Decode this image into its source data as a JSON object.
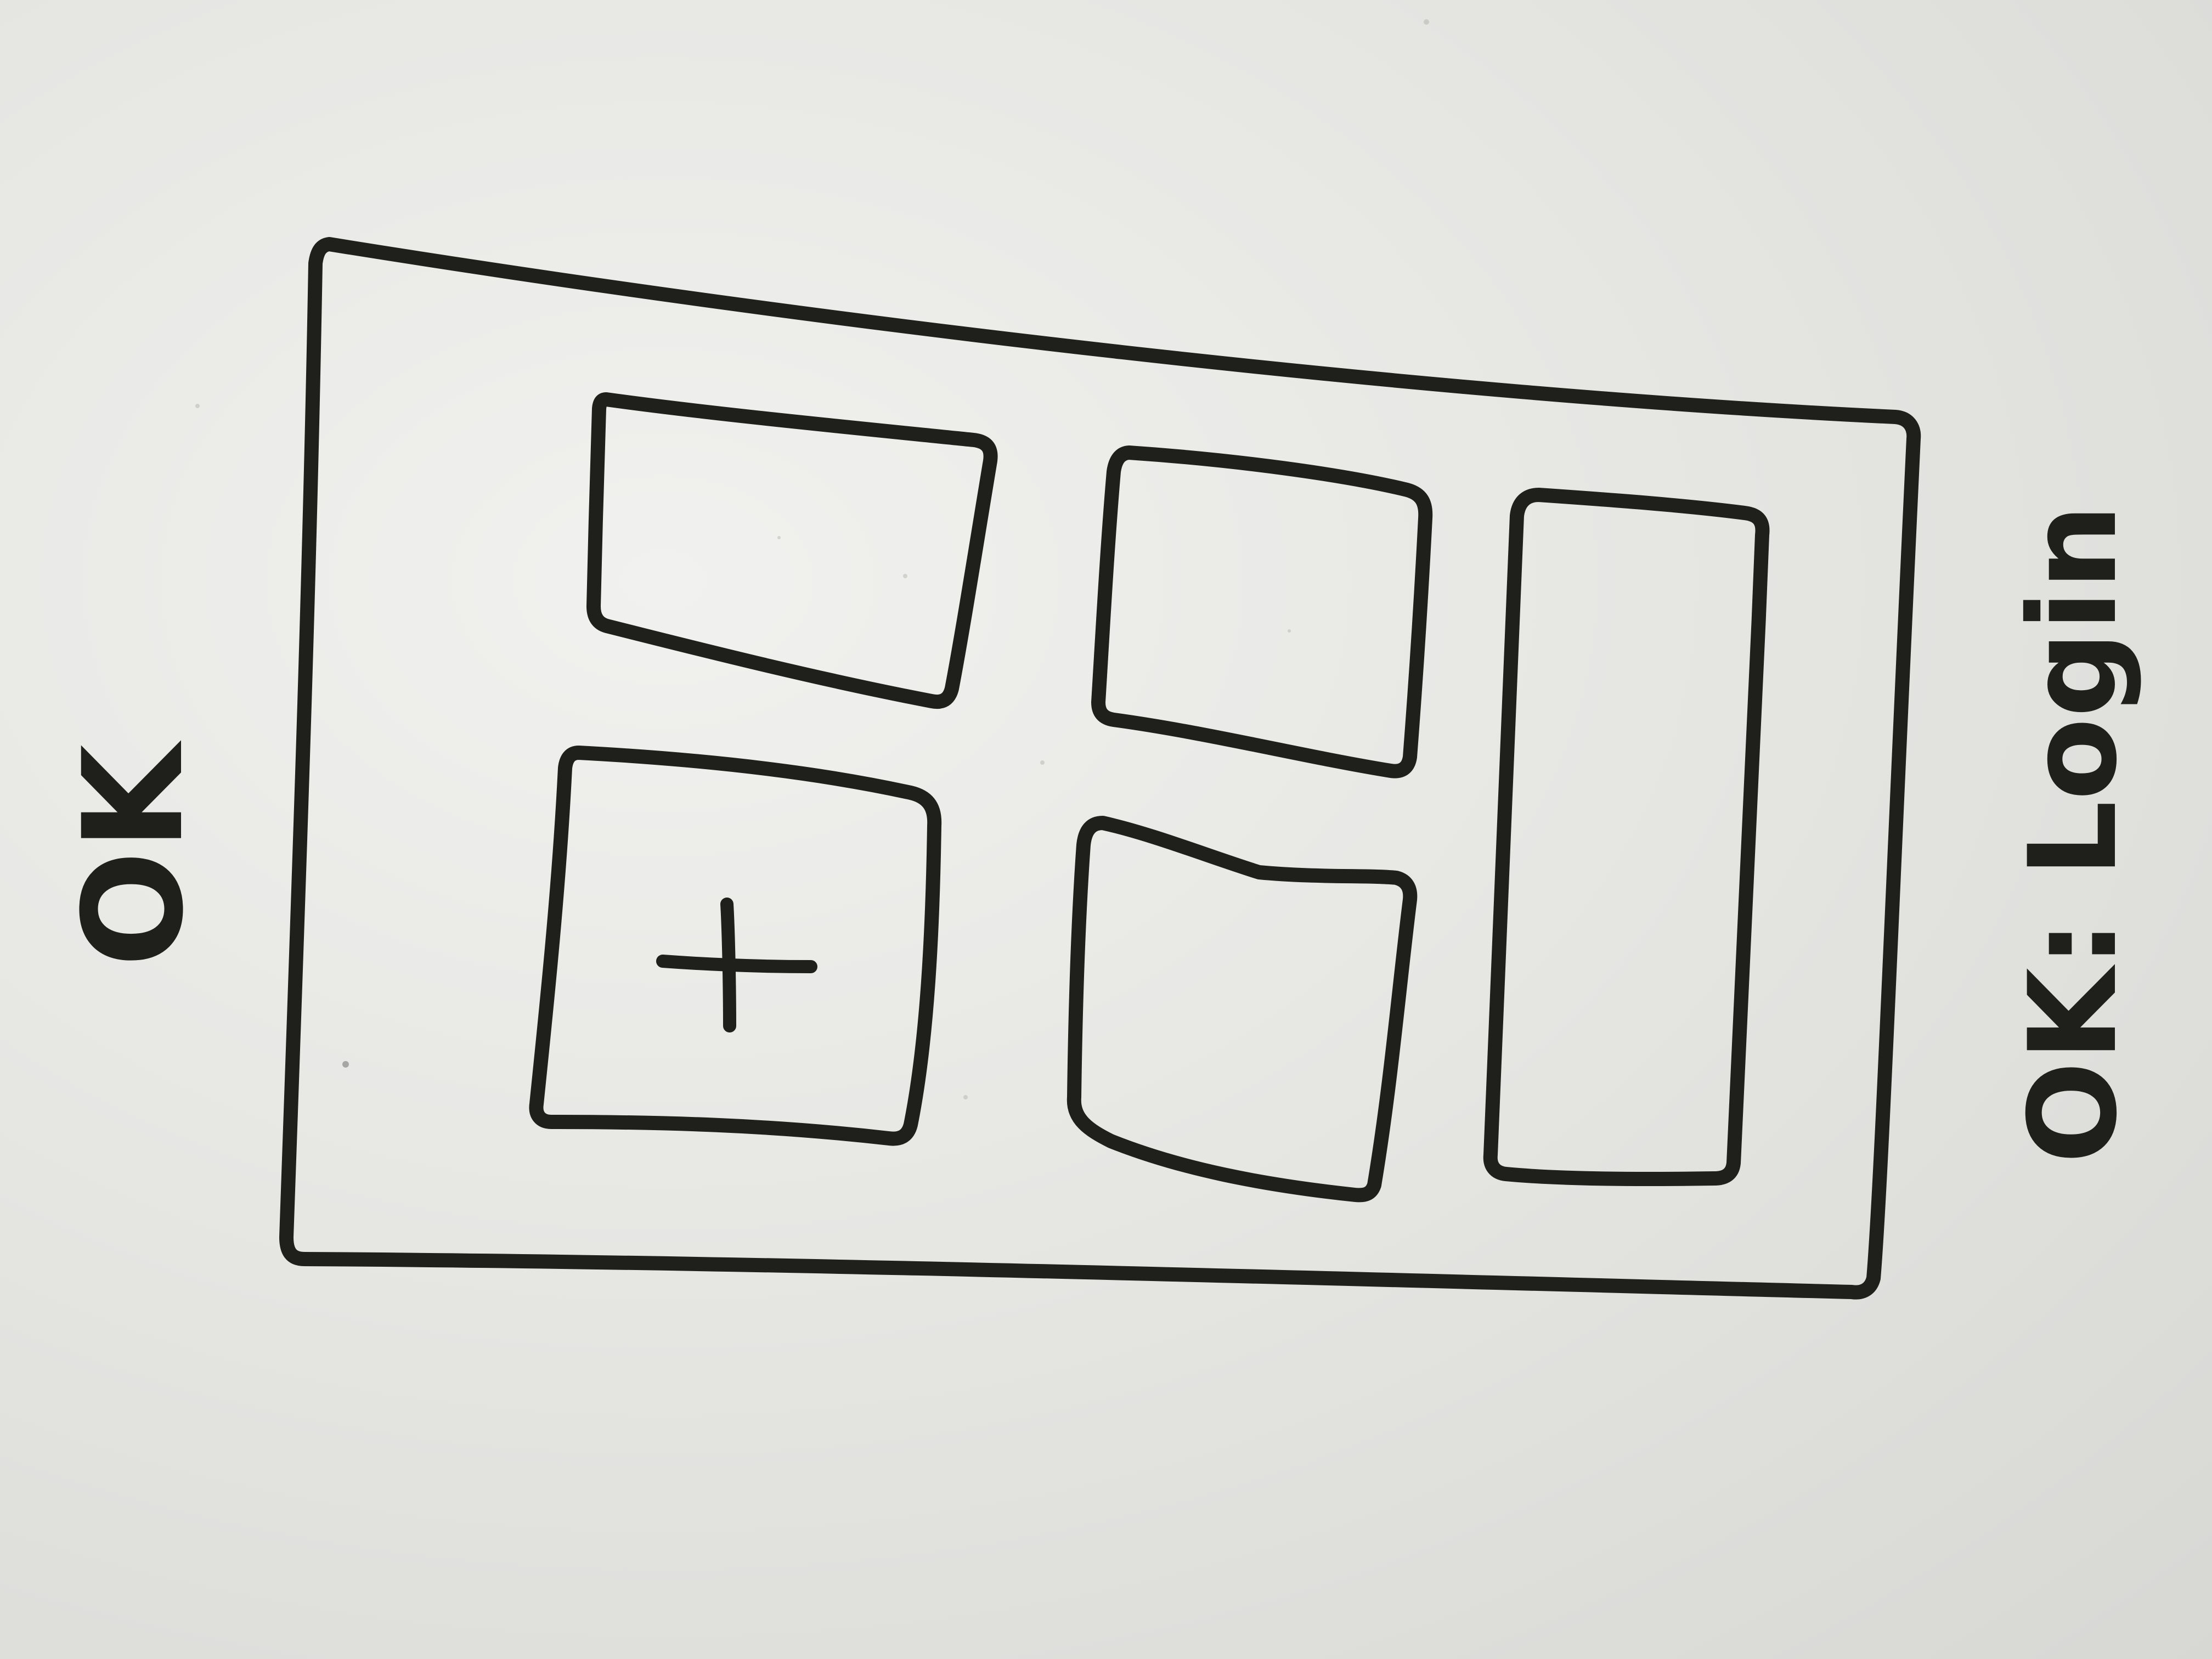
{
  "labels": {
    "top_note": "OK",
    "bottom_note": "OK: Login",
    "add_symbol": "+"
  },
  "colors": {
    "whiteboard": "#e8e8e5",
    "marker": "#1f1f1c"
  },
  "icons": {
    "add_tile": "plus-icon"
  }
}
